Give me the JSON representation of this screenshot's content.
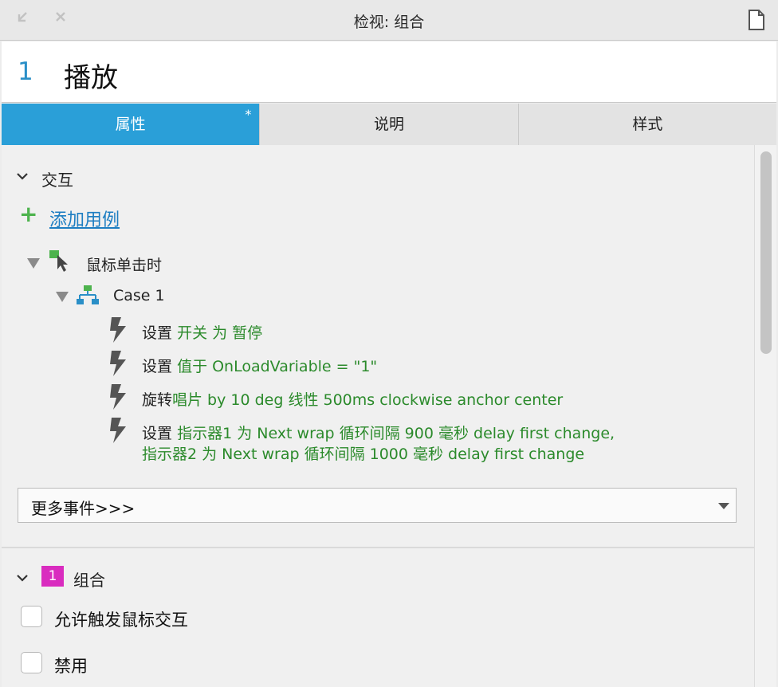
{
  "window": {
    "title": "检视: 组合"
  },
  "header": {
    "number": "1",
    "name": "播放"
  },
  "tabs": [
    {
      "label": "属性",
      "marker": "*"
    },
    {
      "label": "说明"
    },
    {
      "label": "样式"
    }
  ],
  "interaction": {
    "section_title": "交互",
    "add_case_label": "添加用例",
    "event": {
      "label": "鼠标单击时",
      "case_label": "Case 1",
      "actions": [
        {
          "verb": "设置",
          "detail": "开关 为 暂停"
        },
        {
          "verb": "设置",
          "detail": "值于 OnLoadVariable = \"1\""
        },
        {
          "verb": "旋转",
          "detail": "唱片 by 10 deg 线性 500ms clockwise anchor center"
        },
        {
          "verb": "设置",
          "detail": "指示器1 为 Next wrap 循环间隔 900 毫秒 delay first change,",
          "detail2": "指示器2 为 Next wrap 循环间隔 1000 毫秒 delay first change"
        }
      ]
    },
    "more_events": "更多事件>>>"
  },
  "group": {
    "badge": "1",
    "title": "组合",
    "options": [
      {
        "label": "允许触发鼠标交互",
        "checked": false
      },
      {
        "label": "禁用",
        "checked": false
      }
    ]
  },
  "colors": {
    "accent": "#2a9fd8",
    "action_green": "#2b8a2b",
    "link_blue": "#1e7ec2",
    "badge_magenta": "#d92cbf",
    "number_blue": "#2a8fc7"
  }
}
